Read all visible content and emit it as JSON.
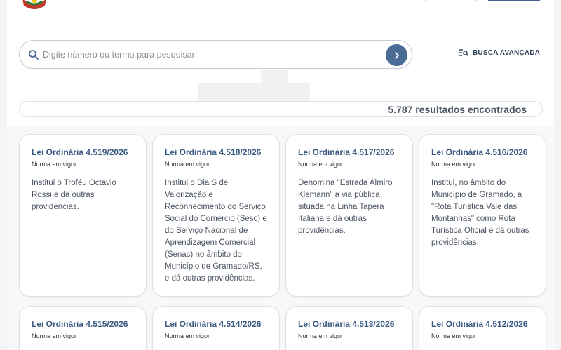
{
  "search": {
    "placeholder": "Digite número ou termo para pesquisar"
  },
  "advanced_search": {
    "label": "BUSCA AVANÇADA"
  },
  "results": {
    "count_text": "5.787 resultados encontrados"
  },
  "cards": [
    {
      "title": "Lei Ordinária 4.519/2026",
      "status": "Norma em vigor",
      "description": "Institui o Troféu Octávio Rossi e dá outras providencias."
    },
    {
      "title": "Lei Ordinária 4.518/2026",
      "status": "Norma em vigor",
      "description": "Institui o Dia S de Valorização e Reconhecimento do Serviço Social do Comércio (Sesc) e do Serviço Nacional de Aprendizagem Comercial (Senac) no âmbito do Município de Gramado/RS, e dá outras providências."
    },
    {
      "title": "Lei Ordinária 4.517/2026",
      "status": "Norma em vigor",
      "description": "Denomina \"Estrada Almiro Klemann\" a via pública situada na Linha Tapera Italiana e dá outras providências."
    },
    {
      "title": "Lei Ordinária 4.516/2026",
      "status": "Norma em vigor",
      "description": "Institui, no âmbito do Município de Gramado, a \"Rota Turística Vale das Montanhas\" como Rota Turística Oficial e dá outras providências."
    },
    {
      "title": "Lei Ordinária 4.515/2026",
      "status": "Norma em vigor",
      "description": ""
    },
    {
      "title": "Lei Ordinária 4.514/2026",
      "status": "Norma em vigor",
      "description": ""
    },
    {
      "title": "Lei Ordinária 4.513/2026",
      "status": "Norma em vigor",
      "description": ""
    },
    {
      "title": "Lei Ordinária 4.512/2026",
      "status": "Norma em vigor",
      "description": ""
    }
  ]
}
